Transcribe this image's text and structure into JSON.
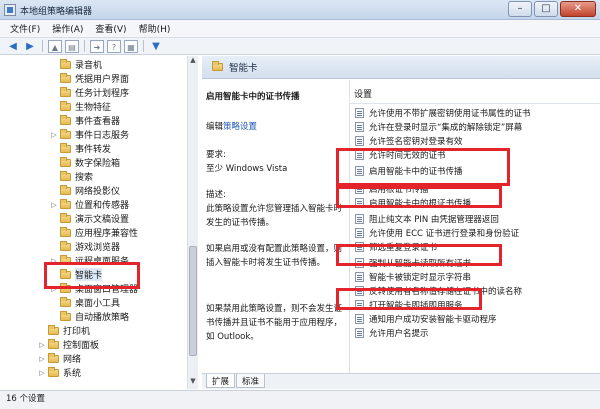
{
  "window": {
    "title": "本地组策略编辑器",
    "controls": [
      "–",
      "□",
      "✕"
    ]
  },
  "menu": [
    "文件(F)",
    "操作(A)",
    "查看(V)",
    "帮助(H)"
  ],
  "toolbar": {
    "back": "◀",
    "forward": "▶"
  },
  "tree": {
    "items": [
      {
        "label": "录音机",
        "expandable": false
      },
      {
        "label": "凭据用户界面",
        "expandable": false
      },
      {
        "label": "任务计划程序",
        "expandable": false
      },
      {
        "label": "生物特征",
        "expandable": false
      },
      {
        "label": "事件查看器",
        "expandable": false
      },
      {
        "label": "事件日志服务",
        "expandable": true
      },
      {
        "label": "事件转发",
        "expandable": false
      },
      {
        "label": "数字保险箱",
        "expandable": false
      },
      {
        "label": "搜索",
        "expandable": false
      },
      {
        "label": "网络投影仪",
        "expandable": false
      },
      {
        "label": "位置和传感器",
        "expandable": true
      },
      {
        "label": "演示文稿设置",
        "expandable": false
      },
      {
        "label": "应用程序兼容性",
        "expandable": false
      },
      {
        "label": "游戏浏览器",
        "expandable": false
      },
      {
        "label": "远程桌面服务",
        "expandable": true
      },
      {
        "label": "智能卡",
        "expandable": false,
        "selected": true
      },
      {
        "label": "桌面窗口管理器",
        "expandable": true
      },
      {
        "label": "桌面小工具",
        "expandable": false
      },
      {
        "label": "自动播放策略",
        "expandable": false
      },
      {
        "label": "打印机",
        "expandable": false,
        "level": 1
      },
      {
        "label": "控制面板",
        "expandable": true,
        "level": 1
      },
      {
        "label": "网络",
        "expandable": true,
        "level": 1
      },
      {
        "label": "系统",
        "expandable": true,
        "level": 1
      }
    ]
  },
  "right_header": {
    "title": "智能卡"
  },
  "description": {
    "policy_title": "启用智能卡中的证书传播",
    "edit_prefix": "编辑",
    "edit_link": "策略设置",
    "requirements_label": "要求:",
    "requirements_value": "至少 Windows Vista",
    "description_label": "描述:",
    "description_text": "此策略设置允许您管理插入智能卡时发生的证书传播。",
    "enabled_text": "如果启用或没有配置此策略设置，则插入智能卡时将发生证书传播。",
    "disabled_text": "如果禁用此策略设置，则不会发生证书传播并且证书不能用于应用程序，如 Outlook。"
  },
  "settings": {
    "column_header": "设置",
    "items": [
      "允许使用不带扩展密钥使用证书属性的证书",
      "允许在登录时显示“集成的解除锁定”屏幕",
      "允许签名密钥对登录有效",
      "允许时间无效的证书",
      "启用智能卡中的证书传播",
      "启用根证书传播",
      "启用智能卡中的根证书传播",
      "阻止纯文本 PIN 由凭据管理器返回",
      "允许使用 ECC 证书进行登录和身份验证",
      "筛选重复登录证书",
      "强制从智能卡读取所有证书",
      "智能卡被锁定时显示字符串",
      "反转使用者名称值存储在证书中的读名称",
      "打开智能卡即插即用服务",
      "通知用户成功安装智能卡驱动程序",
      "允许用户名提示"
    ]
  },
  "tabs": [
    "扩展",
    "标准"
  ],
  "status": "16 个设置"
}
